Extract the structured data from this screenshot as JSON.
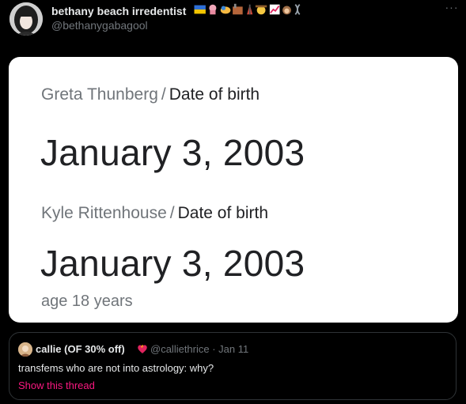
{
  "tweet": {
    "display_name": "bethany beach irredentist",
    "name_emojis": [
      "ukraine-flag-icon",
      "sea-creature-icon",
      "clam-icon",
      "factory-icon",
      "radio-tower-icon",
      "cowboy-face-icon",
      "chart-increasing-icon",
      "monkey-face-icon",
      "dna-icon"
    ],
    "handle": "@bethanygabagool",
    "more_label": "···"
  },
  "media": {
    "entry1": {
      "subject": "Greta Thunberg",
      "separator": "/",
      "field": "Date of birth",
      "value": "January 3, 2003"
    },
    "entry2": {
      "subject": "Kyle Rittenhouse",
      "separator": "/",
      "field": "Date of birth",
      "value": "January 3, 2003",
      "extra": "age 18 years"
    }
  },
  "quote": {
    "name": "callie (OF 30% off)",
    "name_emoji": "fire-heart-icon",
    "handle_date": "@calliethrice · Jan 11",
    "text": "transfems who are not into astrology: why?",
    "link": "Show this thread"
  },
  "colors": {
    "background": "#000000",
    "text_primary": "#e7e9ea",
    "text_secondary": "#71767b",
    "link_pink": "#f91880",
    "border": "#2f3336"
  }
}
